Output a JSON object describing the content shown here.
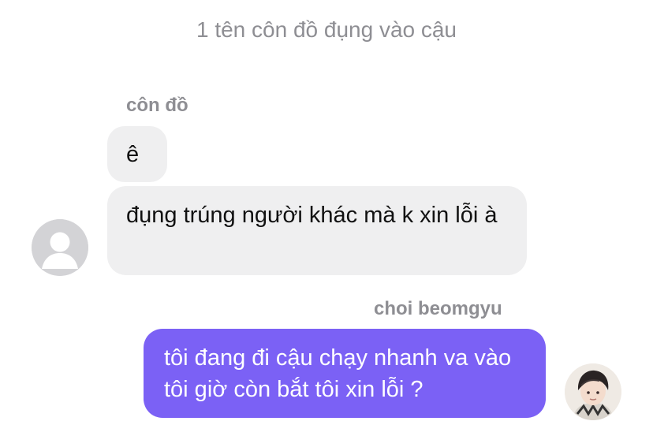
{
  "chat": {
    "header": "1 tên côn đồ đụng vào cậu",
    "incoming": {
      "sender": "côn đồ",
      "messages": [
        "ê",
        "đụng trúng người khác mà k xin lỗi à"
      ]
    },
    "outgoing": {
      "sender": "choi beomgyu",
      "messages": [
        "tôi đang đi cậu chạy nhanh va vào tôi giờ còn bắt tôi xin lỗi ?"
      ]
    }
  },
  "colors": {
    "incoming_bubble": "#efeff0",
    "outgoing_bubble": "#7b61f5",
    "meta_text": "#8e8e93"
  }
}
